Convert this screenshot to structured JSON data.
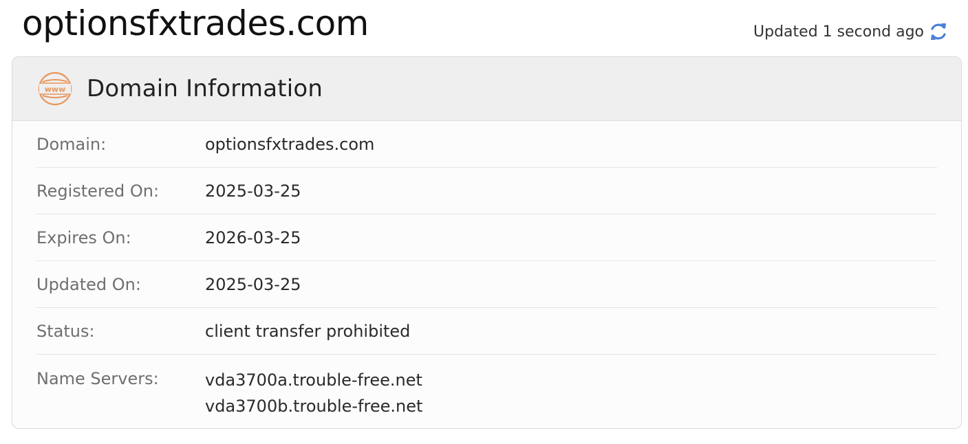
{
  "page": {
    "domain_title": "optionsfxtrades.com",
    "updated_text": "Updated 1 second ago",
    "refresh_icon": "refresh-icon"
  },
  "card": {
    "title": "Domain Information",
    "icon": "www-globe-icon",
    "rows": [
      {
        "label": "Domain:",
        "value": "optionsfxtrades.com"
      },
      {
        "label": "Registered On:",
        "value": "2025-03-25"
      },
      {
        "label": "Expires On:",
        "value": "2026-03-25"
      },
      {
        "label": "Updated On:",
        "value": "2025-03-25"
      },
      {
        "label": "Status:",
        "value": "client transfer prohibited"
      }
    ],
    "name_servers": {
      "label": "Name Servers:",
      "values": [
        "vda3700a.trouble-free.net",
        "vda3700b.trouble-free.net"
      ]
    }
  },
  "colors": {
    "icon_orange": "#e8955a",
    "refresh_blue": "#4a7fd6",
    "header_bg": "#efefef",
    "label_gray": "#6f6f6f"
  }
}
